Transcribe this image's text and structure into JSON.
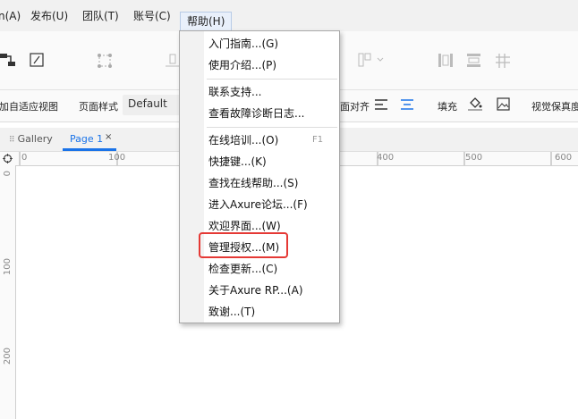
{
  "menubar": {
    "items": [
      "n(A)",
      "发布(U)",
      "团队(T)",
      "账号(C)",
      "帮助(H)"
    ]
  },
  "stylebar": {
    "adaptive_view": "加自适应视图",
    "page_style_label": "页面样式",
    "page_style_value": "Default",
    "page_align_label": "面对齐",
    "fill_label": "填充",
    "visual_fidelity_label": "视觉保真度"
  },
  "tabs": {
    "gallery": "Gallery",
    "page": "Page 1",
    "close": "×"
  },
  "ruler": {
    "h_ticks": [
      "0",
      "100",
      "400",
      "500",
      "600"
    ],
    "v_ticks": [
      "0",
      "100",
      "200"
    ]
  },
  "help_menu": {
    "items": [
      {
        "label": "入门指南...(G)",
        "shortcut": ""
      },
      {
        "label": "使用介绍...(P)",
        "shortcut": ""
      },
      {
        "label": "联系支持...",
        "shortcut": ""
      },
      {
        "label": "查看故障诊断日志...",
        "shortcut": ""
      },
      {
        "label": "在线培训...(O)",
        "shortcut": "F1"
      },
      {
        "label": "快捷键...(K)",
        "shortcut": ""
      },
      {
        "label": "查找在线帮助...(S)",
        "shortcut": ""
      },
      {
        "label": "进入Axure论坛...(F)",
        "shortcut": ""
      },
      {
        "label": "欢迎界面...(W)",
        "shortcut": ""
      },
      {
        "label": "管理授权...(M)",
        "shortcut": ""
      },
      {
        "label": "检查更新...(C)",
        "shortcut": ""
      },
      {
        "label": "关于Axure RP...(A)",
        "shortcut": ""
      },
      {
        "label": "致谢...(T)",
        "shortcut": ""
      }
    ]
  },
  "colors": {
    "accent": "#1a73e8",
    "highlight": "#e53935"
  }
}
